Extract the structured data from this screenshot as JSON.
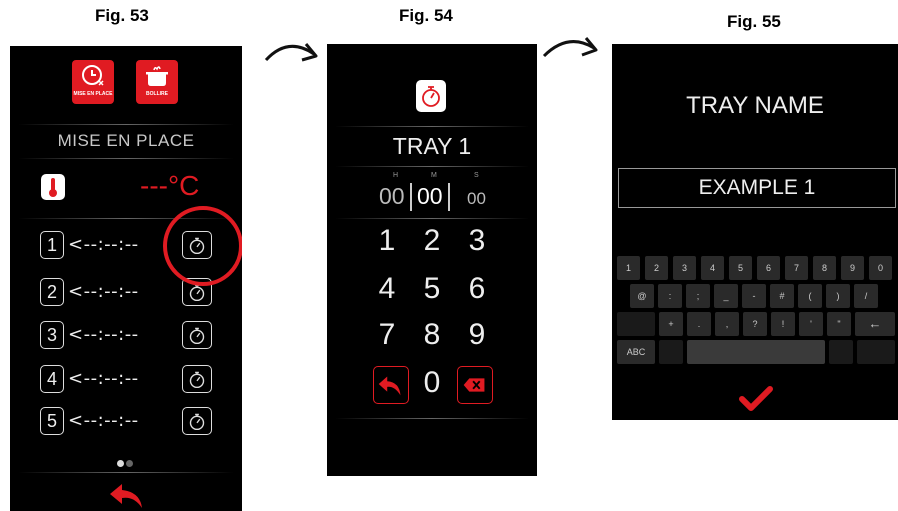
{
  "figures": [
    "Fig. 53",
    "Fig. 54",
    "Fig. 55"
  ],
  "colors": {
    "accent": "#e01b22",
    "screen_bg": "#000000",
    "text": "#eeeeee"
  },
  "screen1": {
    "modes": [
      {
        "label": "MISE EN PLACE",
        "icon": "clock-icon"
      },
      {
        "label": "BOLLIRE",
        "icon": "pot-icon"
      }
    ],
    "title": "MISE EN PLACE",
    "temperature": "---°C",
    "trays": [
      {
        "num": "1",
        "time": "<--:--:--"
      },
      {
        "num": "2",
        "time": "<--:--:--"
      },
      {
        "num": "3",
        "time": "<--:--:--"
      },
      {
        "num": "4",
        "time": "<--:--:--"
      },
      {
        "num": "5",
        "time": "<--:--:--"
      }
    ],
    "page_count": 2,
    "active_page": 1
  },
  "screen2": {
    "title": "TRAY 1",
    "time": {
      "h_label": "H",
      "m_label": "M",
      "s_label": "S",
      "h": "00",
      "m": "00",
      "s": "00"
    },
    "keys": [
      "1",
      "2",
      "3",
      "4",
      "5",
      "6",
      "7",
      "8",
      "9",
      "0"
    ]
  },
  "screen3": {
    "title": "TRAY NAME",
    "value": "EXAMPLE 1",
    "keyboard": {
      "row1": [
        "1",
        "2",
        "3",
        "4",
        "5",
        "6",
        "7",
        "8",
        "9",
        "0"
      ],
      "row2": [
        "@",
        ":",
        ";",
        "_",
        "-",
        "#",
        "(",
        ")",
        "/"
      ],
      "row3": [
        "+",
        ".",
        ",",
        "?",
        "!",
        "'",
        "\""
      ],
      "backspace": "←",
      "mode_key": "ABC"
    }
  }
}
